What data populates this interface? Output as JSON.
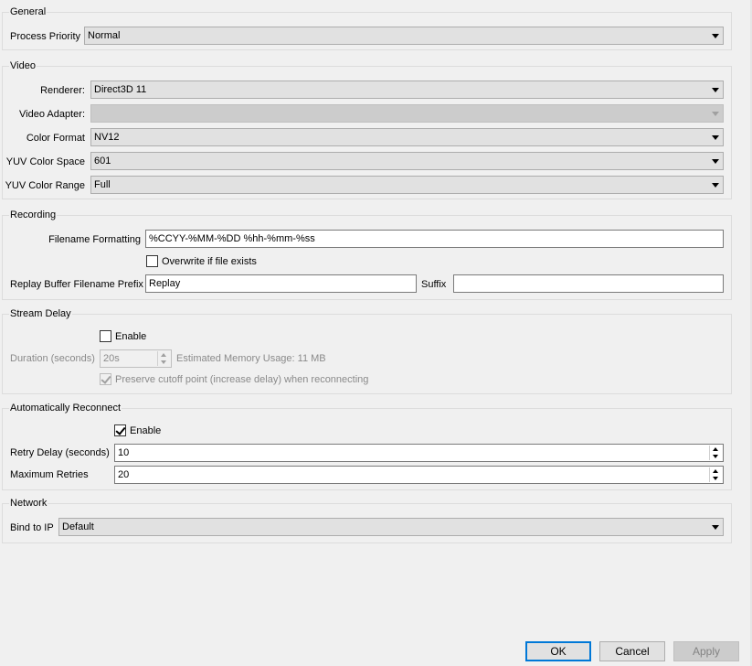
{
  "general": {
    "title": "General",
    "process_priority_label": "Process Priority",
    "process_priority_value": "Normal"
  },
  "video": {
    "title": "Video",
    "renderer_label": "Renderer:",
    "renderer_value": "Direct3D 11",
    "adapter_label": "Video Adapter:",
    "adapter_value": "",
    "color_format_label": "Color Format",
    "color_format_value": "NV12",
    "yuv_space_label": "YUV Color Space",
    "yuv_space_value": "601",
    "yuv_range_label": "YUV Color Range",
    "yuv_range_value": "Full"
  },
  "recording": {
    "title": "Recording",
    "filename_label": "Filename Formatting",
    "filename_value": "%CCYY-%MM-%DD %hh-%mm-%ss",
    "overwrite_label": "Overwrite if file exists",
    "overwrite_checked": false,
    "replay_prefix_label": "Replay Buffer Filename Prefix",
    "replay_prefix_value": "Replay",
    "suffix_label": "Suffix",
    "suffix_value": ""
  },
  "stream_delay": {
    "title": "Stream Delay",
    "enable_label": "Enable",
    "enable_checked": false,
    "duration_label": "Duration (seconds)",
    "duration_value": "20s",
    "memory_text": "Estimated Memory Usage: 11 MB",
    "preserve_label": "Preserve cutoff point (increase delay) when reconnecting",
    "preserve_checked": true
  },
  "reconnect": {
    "title": "Automatically Reconnect",
    "enable_label": "Enable",
    "enable_checked": true,
    "retry_delay_label": "Retry Delay (seconds)",
    "retry_delay_value": "10",
    "max_retries_label": "Maximum Retries",
    "max_retries_value": "20"
  },
  "network": {
    "title": "Network",
    "bind_label": "Bind to IP",
    "bind_value": "Default"
  },
  "buttons": {
    "ok": "OK",
    "cancel": "Cancel",
    "apply": "Apply"
  }
}
